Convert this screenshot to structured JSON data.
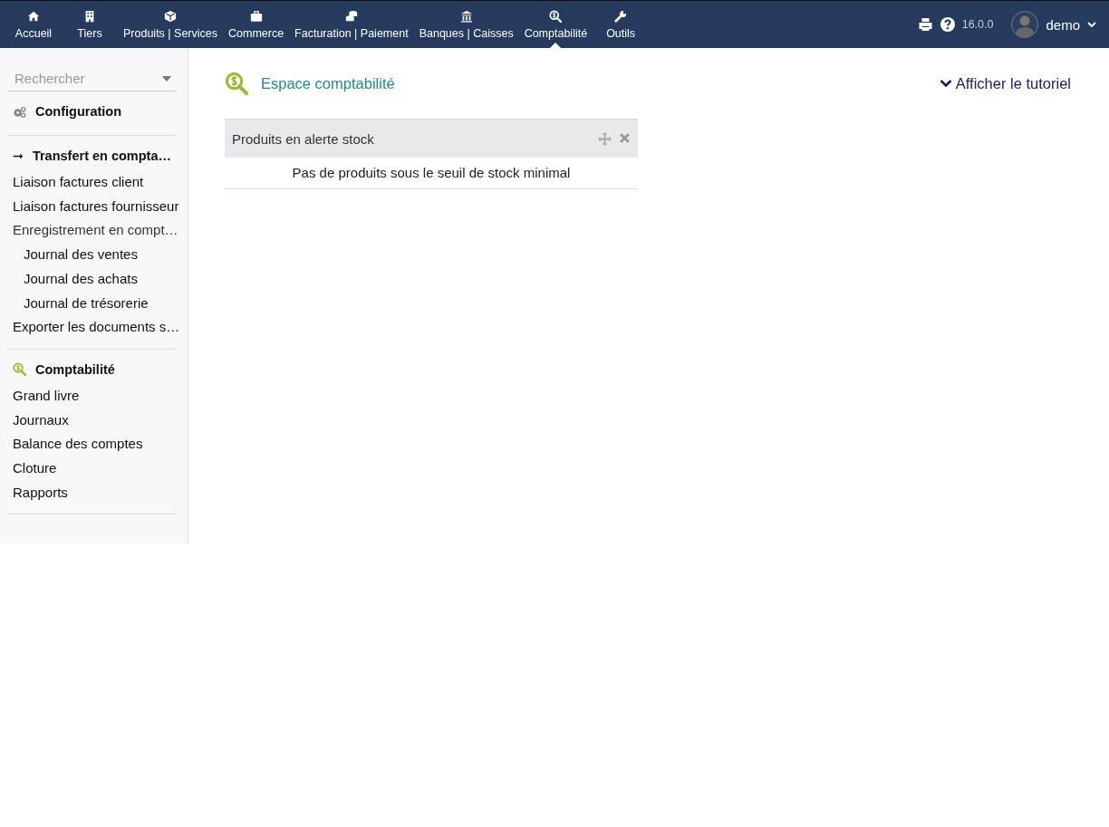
{
  "top_menu": [
    {
      "label": "Accueil",
      "kind": "home",
      "selected": false
    },
    {
      "label": "Tiers",
      "kind": "building",
      "selected": false
    },
    {
      "label": "Produits | Services",
      "kind": "cube",
      "selected": false
    },
    {
      "label": "Commerce",
      "kind": "briefcase",
      "selected": false
    },
    {
      "label": "Facturation | Paiement",
      "kind": "coins",
      "selected": false
    },
    {
      "label": "Banques | Caisses",
      "kind": "bank",
      "selected": false
    },
    {
      "label": "Comptabilité",
      "kind": "accounting",
      "selected": true
    },
    {
      "label": "Outils",
      "kind": "tools",
      "selected": false
    }
  ],
  "toolbar": {
    "version": "16.0.0",
    "user": "demo"
  },
  "sidebar": {
    "search": {
      "placeholder": "Rechercher"
    },
    "sections": [
      {
        "title": "Configuration",
        "kind": "setup"
      },
      {
        "title": "Transfert en compta…",
        "kind": "transfer",
        "items": [
          {
            "label": "Liaison factures client"
          },
          {
            "label": "Liaison factures fournisseur"
          },
          {
            "label": "Enregistrement en compt…",
            "children": [
              {
                "label": "Journal des ventes"
              },
              {
                "label": "Journal des achats"
              },
              {
                "label": "Journal de trésorerie"
              }
            ]
          },
          {
            "label": "Exporter les documents s…"
          }
        ]
      },
      {
        "title": "Comptabilité",
        "kind": "accounting",
        "items": [
          {
            "label": "Grand livre"
          },
          {
            "label": "Journaux"
          },
          {
            "label": "Balance des comptes"
          },
          {
            "label": "Cloture"
          },
          {
            "label": "Rapports"
          }
        ]
      }
    ]
  },
  "main": {
    "title": "Espace comptabilité",
    "tutorial_link": "Afficher le tutoriel",
    "widget": {
      "title": "Produits en alerte stock",
      "message": "Pas de produits sous le seuil de stock minimal"
    }
  }
}
